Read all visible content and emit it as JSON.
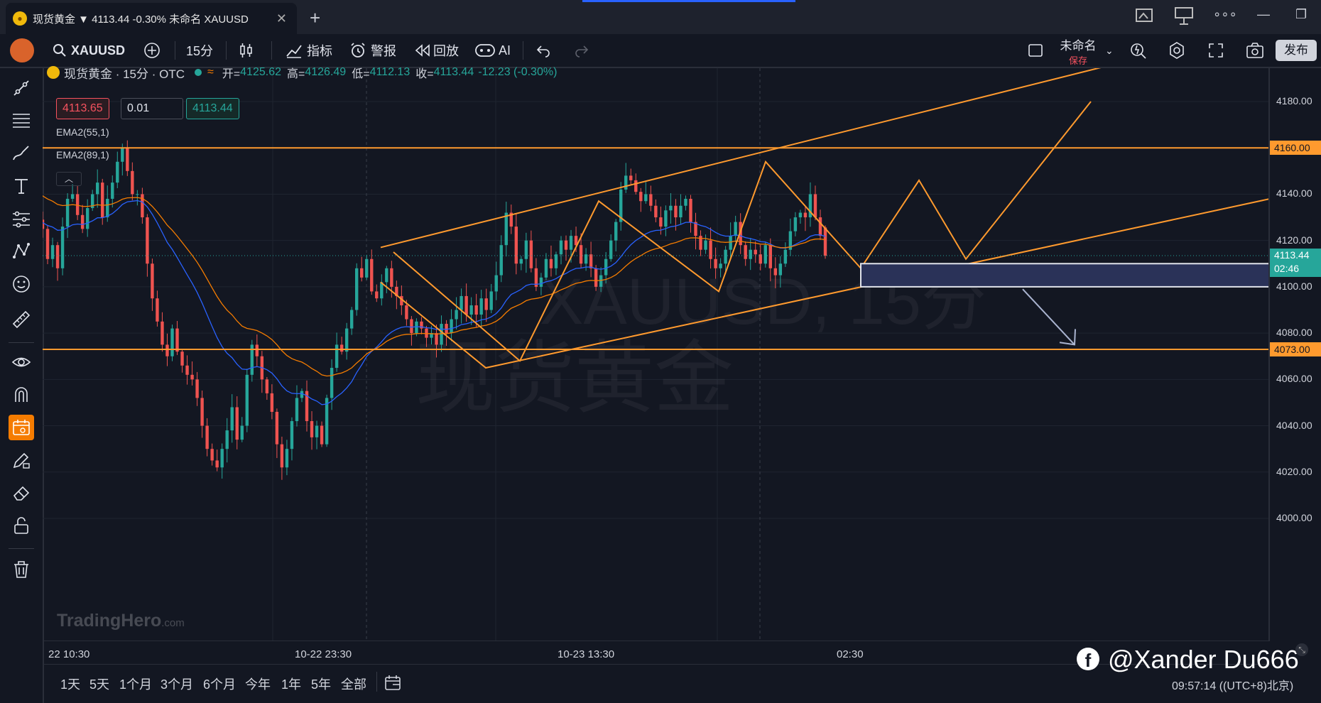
{
  "window": {
    "tab_title": "现货黄金 ▼ 4113.44 -0.30% 未命名 XAUUSD",
    "close": "✕",
    "new_tab": "+"
  },
  "toolbar": {
    "symbol": "XAUUSD",
    "interval": "15分",
    "indicators": "指标",
    "alerts": "警报",
    "replay": "回放",
    "ai": "AI",
    "layout_name": "未命名",
    "save": "保存",
    "publish": "发布"
  },
  "legend": {
    "title": "现货黄金 · 15分 · OTC",
    "open_label": "开=",
    "open": "4125.62",
    "high_label": "高=",
    "high": "4126.49",
    "low_label": "低=",
    "low": "4112.13",
    "close_label": "收=",
    "close": "4113.44",
    "change": "-12.23 (-0.30%)",
    "sell_price": "4113.65",
    "quantity": "0.01",
    "buy_price": "4113.44",
    "ema1": "EMA2(55,1)",
    "ema2": "EMA2(89,1)"
  },
  "watermark": {
    "symbol": "XAUUSD, 15分",
    "name": "现货黄金",
    "brand": "TradingHero",
    "brand_suffix": ".com"
  },
  "price_axis": {
    "ticks": [
      "4180.00",
      "4140.00",
      "4120.00",
      "4100.00",
      "4080.00",
      "4060.00",
      "4040.00",
      "4020.00",
      "4000.00"
    ],
    "level_upper": "4160.00",
    "level_lower": "4073.00",
    "current_price": "4113.44",
    "countdown": "02:46"
  },
  "time_axis": {
    "ticks": [
      "22 10:30",
      "10-22 23:30",
      "10-23 13:30",
      "02:30"
    ]
  },
  "ranges": [
    "1天",
    "5天",
    "1个月",
    "3个月",
    "6个月",
    "今年",
    "1年",
    "5年",
    "全部"
  ],
  "footer": {
    "handle": "@Xander Du666",
    "clock": "09:57:14 ((UTC+8)北京)"
  },
  "colors": {
    "background": "#131722",
    "bull": "#26a69a",
    "bear": "#ef5350",
    "drawing": "#ff9a2e",
    "ema55": "#2962ff",
    "ema89": "#f57c00",
    "zone": "#2a3258"
  },
  "chart_data": {
    "type": "candlestick",
    "symbol": "XAUUSD",
    "interval": "15分",
    "ylim": [
      3995,
      4205
    ],
    "y_ticks": [
      4000,
      4020,
      4040,
      4060,
      4080,
      4100,
      4120,
      4140,
      4160,
      4180
    ],
    "horizontal_levels": [
      4160.0,
      4073.0
    ],
    "last_price": 4113.44,
    "ohlc_last": {
      "open": 4125.62,
      "high": 4126.49,
      "low": 4112.13,
      "close": 4113.44
    },
    "closes": [
      4125,
      4112,
      4118,
      4108,
      4126,
      4138,
      4140,
      4131,
      4125,
      4134,
      4140,
      4145,
      4130,
      4138,
      4145,
      4154,
      4160,
      4150,
      4140,
      4140,
      4130,
      4110,
      4095,
      4085,
      4075,
      4070,
      4082,
      4072,
      4066,
      4062,
      4060,
      4052,
      4040,
      4030,
      4025,
      4022,
      4030,
      4038,
      4048,
      4034,
      4040,
      4062,
      4075,
      4070,
      4060,
      4054,
      4046,
      4032,
      4022,
      4030,
      4042,
      4052,
      4055,
      4042,
      4035,
      4040,
      4032,
      4052,
      4065,
      4075,
      4072,
      4082,
      4090,
      4108,
      4104,
      4112,
      4098,
      4095,
      4102,
      4108,
      4100,
      4096,
      4092,
      4086,
      4080,
      4085,
      4082,
      4078,
      4080,
      4075,
      4084,
      4080,
      4086,
      4090,
      4096,
      4088,
      4092,
      4088,
      4095,
      4090,
      4098,
      4105,
      4118,
      4132,
      4126,
      4110,
      4112,
      4120,
      4108,
      4100,
      4104,
      4112,
      4108,
      4114,
      4120,
      4116,
      4122,
      4118,
      4110,
      4114,
      4108,
      4100,
      4105,
      4112,
      4120,
      4128,
      4142,
      4148,
      4146,
      4141,
      4137,
      4140,
      4135,
      4130,
      4126,
      4133,
      4135,
      4130,
      4135,
      4138,
      4128,
      4122,
      4116,
      4120,
      4112,
      4108,
      4110,
      4116,
      4122,
      4128,
      4118,
      4112,
      4116,
      4114,
      4110,
      4118,
      4108,
      4105,
      4110,
      4116,
      4124,
      4130,
      4132,
      4130,
      4140,
      4130,
      4122,
      4113.44
    ]
  }
}
